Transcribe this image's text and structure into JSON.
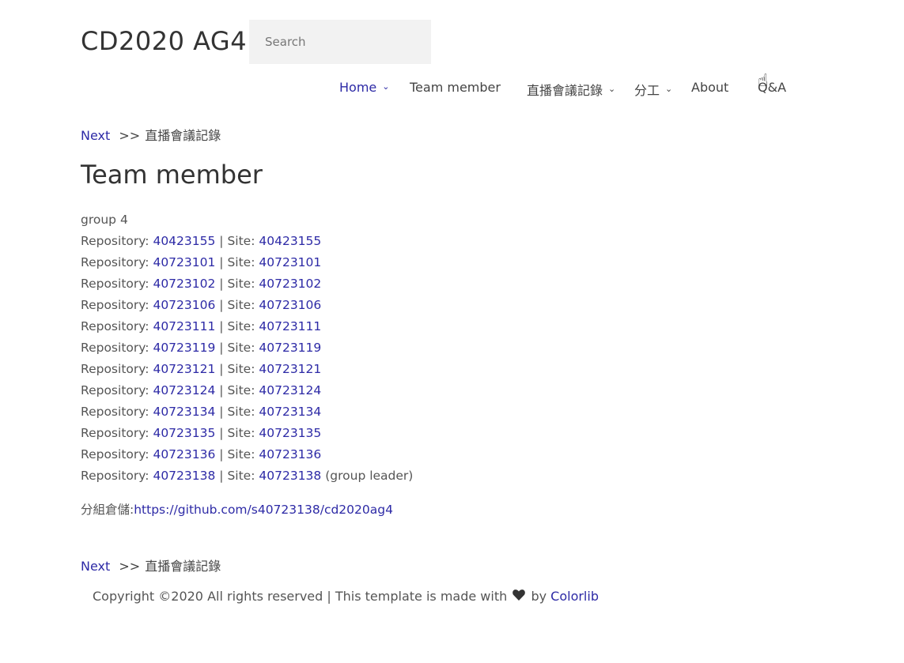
{
  "header": {
    "site_title": "CD2020 AG4",
    "search_placeholder": "Search"
  },
  "nav": [
    {
      "label": "Home",
      "has_dropdown": true,
      "active": true
    },
    {
      "label": "Team member",
      "has_dropdown": false,
      "active": false
    },
    {
      "label": "直播會議記錄",
      "has_dropdown": true,
      "active": false
    },
    {
      "label": "分工",
      "has_dropdown": true,
      "active": false
    },
    {
      "label": "About",
      "has_dropdown": false,
      "active": false
    },
    {
      "label": "Q&A",
      "has_dropdown": false,
      "active": false
    }
  ],
  "breadcrumb": {
    "next_label": "Next",
    "separator": ">>",
    "target": "直播會議記錄"
  },
  "page": {
    "title": "Team member",
    "group_label": "group 4",
    "repo_prefix": "Repository:",
    "site_prefix": "| Site:",
    "members": [
      {
        "id": "40423155",
        "note": ""
      },
      {
        "id": "40723101",
        "note": ""
      },
      {
        "id": "40723102",
        "note": ""
      },
      {
        "id": "40723106",
        "note": ""
      },
      {
        "id": "40723111",
        "note": ""
      },
      {
        "id": "40723119",
        "note": ""
      },
      {
        "id": "40723121",
        "note": ""
      },
      {
        "id": "40723124",
        "note": ""
      },
      {
        "id": "40723134",
        "note": ""
      },
      {
        "id": "40723135",
        "note": ""
      },
      {
        "id": "40723136",
        "note": ""
      },
      {
        "id": "40723138",
        "note": "(group leader)"
      }
    ],
    "group_repo_label": "分組倉儲:",
    "group_repo_url": "https://github.com/s40723138/cd2020ag4"
  },
  "footer": {
    "text_before": "Copyright ©2020 All rights reserved | This template is made with",
    "heart_icon": "heart-icon",
    "by": "by",
    "brand": "Colorlib"
  },
  "colors": {
    "link": "#2d2aa6",
    "text": "#555555",
    "search_bg": "#f2f2f2"
  }
}
